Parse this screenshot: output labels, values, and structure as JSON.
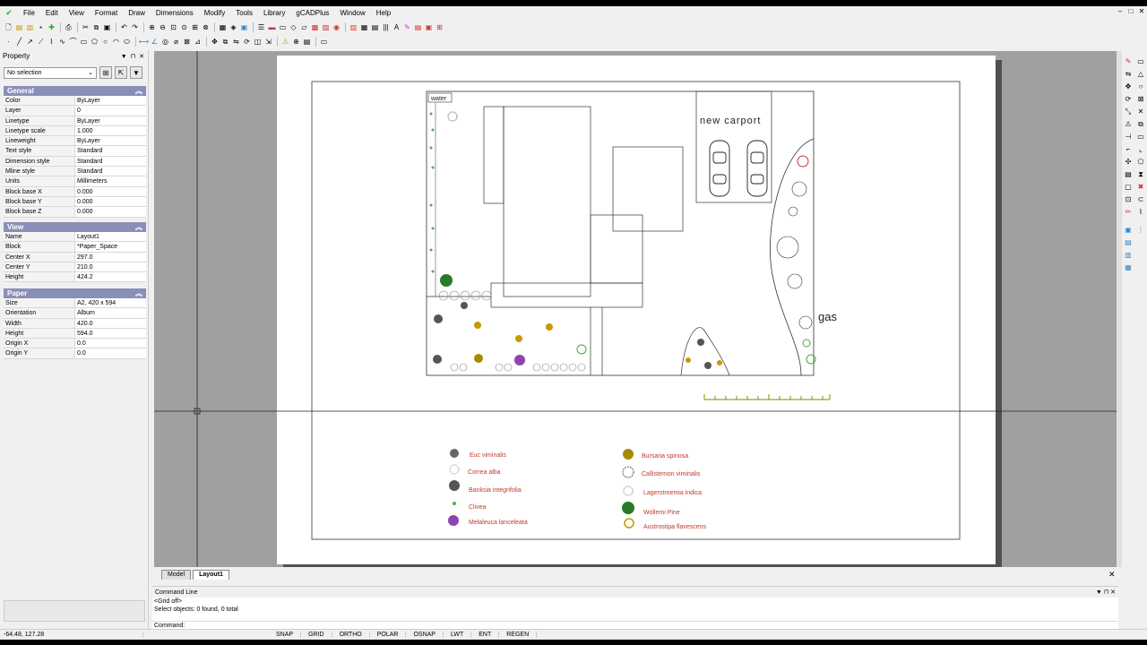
{
  "app": {
    "icon": "gcad-logo-icon"
  },
  "menu": [
    "File",
    "Edit",
    "View",
    "Format",
    "Draw",
    "Dimensions",
    "Modify",
    "Tools",
    "Library",
    "gCADPlus",
    "Window",
    "Help"
  ],
  "window_controls": [
    "–",
    "□",
    "✕"
  ],
  "property": {
    "title": "Property",
    "selection": "No selection",
    "sections": [
      {
        "name": "General",
        "rows": [
          [
            "Color",
            "ByLayer"
          ],
          [
            "Layer",
            "0"
          ],
          [
            "Linetype",
            "ByLayer"
          ],
          [
            "Linetype scale",
            "1.000"
          ],
          [
            "Lineweight",
            "ByLayer"
          ],
          [
            "Text style",
            "Standard"
          ],
          [
            "Dimension style",
            "Standard"
          ],
          [
            "Mline style",
            "Standard"
          ],
          [
            "Units",
            "Millimeters"
          ],
          [
            "Block base X",
            "0.000"
          ],
          [
            "Block base Y",
            "0.000"
          ],
          [
            "Block base Z",
            "0.000"
          ]
        ]
      },
      {
        "name": "View",
        "rows": [
          [
            "Name",
            "Layout1"
          ],
          [
            "Block",
            "*Paper_Space"
          ],
          [
            "Center X",
            "297.0"
          ],
          [
            "Center Y",
            "210.0"
          ],
          [
            "Height",
            "424.2"
          ]
        ]
      },
      {
        "name": "Paper",
        "rows": [
          [
            "Size",
            "A2, 420 x 594"
          ],
          [
            "Orientation",
            "Album"
          ],
          [
            "Width",
            "420.0"
          ],
          [
            "Height",
            "594.0"
          ],
          [
            "Origin X",
            "0.0"
          ],
          [
            "Origin Y",
            "0.0"
          ]
        ]
      }
    ]
  },
  "drawing": {
    "labels": {
      "water": "water",
      "carport": "new carport",
      "gas": "gas"
    },
    "legend_left": [
      "Euc viminalis",
      "Correa alba",
      "Banksia integrifolia",
      "Clivea",
      "Melaleuca lanceleata"
    ],
    "legend_right": [
      "Bursaria spinosa",
      "Callistemon viminalis",
      "Lagerstroemia indica",
      "Wollemi Pine",
      "Austrostipa flavescens"
    ]
  },
  "tabs": [
    "Model",
    "Layout1"
  ],
  "active_tab": "Layout1",
  "command": {
    "title": "Command Line",
    "history": [
      "<Grid off>",
      "Select objects: 0 found,  0 total"
    ],
    "prompt": "Command:"
  },
  "status": {
    "coords": "-64.48,  127.28",
    "buttons": [
      "SNAP",
      "GRID",
      "ORTHO",
      "POLAR",
      "OSNAP",
      "LWT",
      "ENT",
      "REGEN"
    ]
  },
  "colors": {
    "legend_text": "#c0392b",
    "section_header": "#8a8fb8",
    "canvas_bg": "#a0a0a0"
  }
}
